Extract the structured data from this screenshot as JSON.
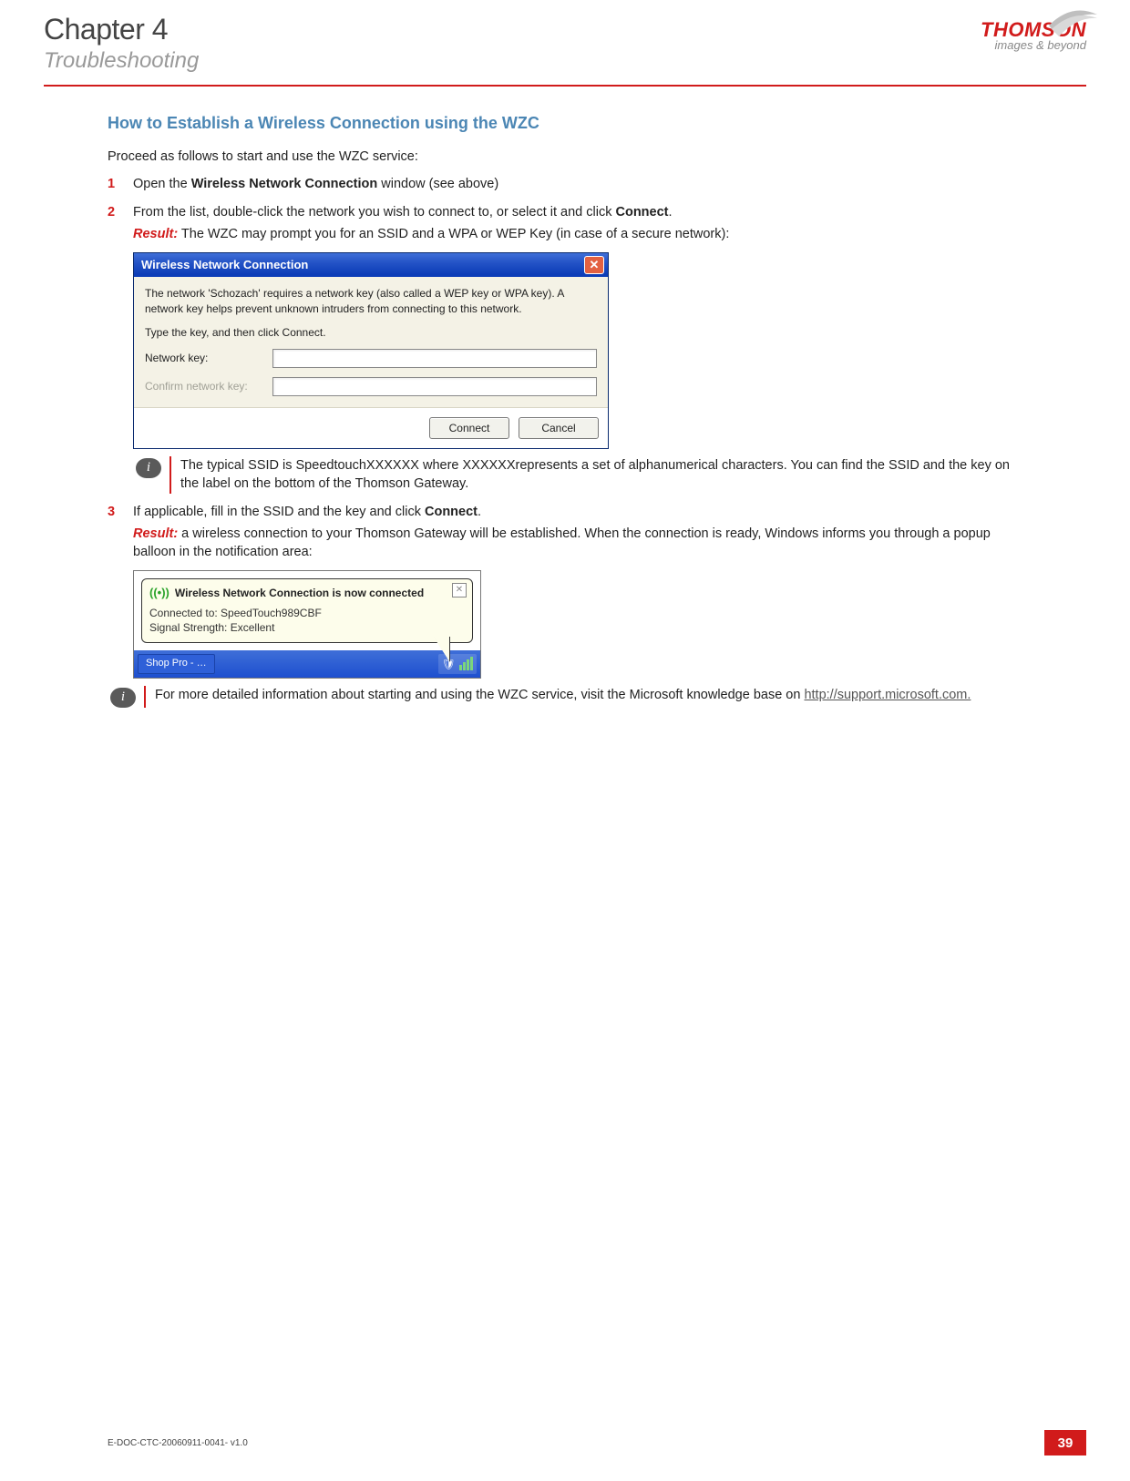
{
  "header": {
    "chapter": "Chapter 4",
    "subtitle": "Troubleshooting",
    "brand": "THOMSON",
    "tagline": "images & beyond"
  },
  "section_title": "How to Establish a Wireless Connection using the WZC",
  "intro": "Proceed as follows to start and use the WZC service:",
  "steps": {
    "s1": {
      "num": "1",
      "t1": "Open the ",
      "bold1": "Wireless Network Connection",
      "t2": " window (see above)"
    },
    "s2": {
      "num": "2",
      "t1": "From the list, double-click the network you wish to connect to, or select it and click ",
      "bold1": "Connect",
      "t2": ".",
      "result_label": "Result:",
      "result_text": " The WZC may prompt you for an SSID and a WPA or WEP Key (in case of a secure network):"
    },
    "s3": {
      "num": "3",
      "t1": "If applicable, fill in the SSID and the key and click ",
      "bold1": "Connect",
      "t2": ".",
      "result_label": "Result:",
      "result_text": " a wireless connection to your Thomson Gateway will be established. When the connection is ready, Windows informs you through a popup balloon in the notification area:"
    }
  },
  "dialog1": {
    "title": "Wireless Network Connection",
    "body_line1": "The network 'Schozach' requires a network key (also called a WEP key or WPA key). A network key helps prevent unknown intruders from connecting to this network.",
    "body_line2": "Type the key, and then click Connect.",
    "label_key": "Network key:",
    "label_confirm": "Confirm network key:",
    "btn_connect": "Connect",
    "btn_cancel": "Cancel"
  },
  "note1": "The typical SSID is SpeedtouchXXXXXX where XXXXXXrepresents a set of alphanumerical characters. You can find the SSID and the key on the label on the bottom of the Thomson Gateway.",
  "balloon": {
    "heading": "Wireless Network Connection is now connected",
    "line1": "Connected to: SpeedTouch989CBF",
    "line2": "Signal Strength: Excellent",
    "taskbar_item": "Shop Pro - …"
  },
  "note2": {
    "text_a": "For more detailed information about starting and using the WZC service, visit the Microsoft knowledge base on ",
    "link": "http://support.microsoft.com."
  },
  "footer": {
    "docid": "E-DOC-CTC-20060911-0041- v1.0",
    "page": "39"
  }
}
